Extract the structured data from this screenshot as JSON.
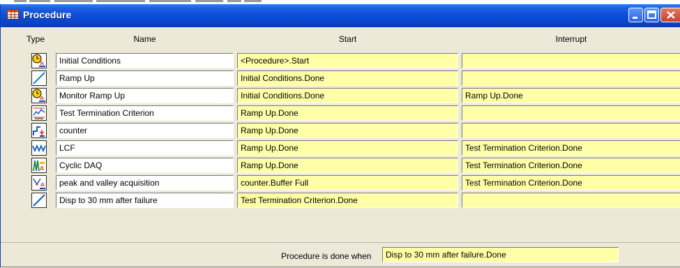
{
  "window": {
    "title": "Procedure",
    "icon": "grid-table-icon"
  },
  "columns": {
    "type": "Type",
    "name": "Name",
    "start": "Start",
    "interrupt": "Interrupt"
  },
  "rows": [
    {
      "icon": "clock-signal-icon",
      "name": "Initial Conditions",
      "start": "<Procedure>.Start",
      "interrupt": ""
    },
    {
      "icon": "ramp-icon",
      "name": "Ramp Up",
      "start": "Initial Conditions.Done",
      "interrupt": ""
    },
    {
      "icon": "clock-signal-icon",
      "name": "Monitor Ramp Up",
      "start": "Initial Conditions.Done",
      "interrupt": "Ramp Up.Done"
    },
    {
      "icon": "limit-detector-icon",
      "name": "Test Termination Criterion",
      "start": "Ramp Up.Done",
      "interrupt": ""
    },
    {
      "icon": "counter-icon",
      "name": "counter",
      "start": "Ramp Up.Done",
      "interrupt": ""
    },
    {
      "icon": "cyclic-wave-icon",
      "name": "LCF",
      "start": "Ramp Up.Done",
      "interrupt": "Test Termination Criterion.Done"
    },
    {
      "icon": "cyclic-daq-icon",
      "name": "Cyclic DAQ",
      "start": "Ramp Up.Done",
      "interrupt": "Test Termination Criterion.Done"
    },
    {
      "icon": "peak-valley-icon",
      "name": "peak and valley acquisition",
      "start": "counter.Buffer Full",
      "interrupt": "Test Termination Criterion.Done"
    },
    {
      "icon": "ramp-icon",
      "name": "Disp to 30 mm after failure",
      "start": "Test Termination Criterion.Done",
      "interrupt": ""
    }
  ],
  "footer": {
    "label": "Procedure is done when",
    "value": "Disp to 30 mm after failure.Done"
  },
  "colors": {
    "titlebar": "#0b4bd6",
    "field_yellow": "#ffffa8",
    "panel": "#ece9d8"
  }
}
